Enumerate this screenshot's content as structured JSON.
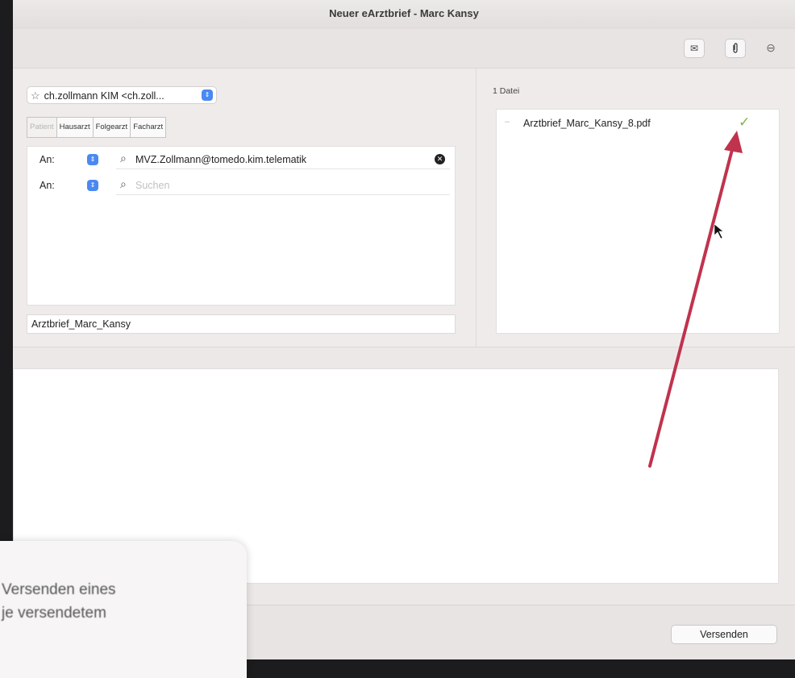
{
  "window": {
    "title": "Neuer eArztbrief - Marc Kansy"
  },
  "toolbar": {
    "icons": [
      "mail-icon",
      "paperclip-icon",
      "minus-circle-icon"
    ]
  },
  "sender": {
    "label": "ch.zollmann KIM <ch.zoll..."
  },
  "recipient_tabs": [
    "Patient",
    "Hausarzt",
    "Folgearzt",
    "Facharzt"
  ],
  "recipients": [
    {
      "type_label": "An:",
      "value": "MVZ.Zollmann@tomedo.kim.telematik",
      "placeholder": ""
    },
    {
      "type_label": "An:",
      "value": "",
      "placeholder": "Suchen"
    }
  ],
  "subject": {
    "value": "Arztbrief_Marc_Kansy"
  },
  "attachments": {
    "count_label": "1 Datei",
    "files": [
      {
        "name": "Arztbrief_Marc_Kansy_8.pdf",
        "status": "check-icon"
      }
    ]
  },
  "footer": {
    "send_label": "Versenden"
  },
  "notification": {
    "lines": [
      "Versenden eines",
      "je versendetem"
    ]
  },
  "colors": {
    "accent": "#4a89f2",
    "arrow": "#c0334d",
    "check": "#7ab648"
  }
}
